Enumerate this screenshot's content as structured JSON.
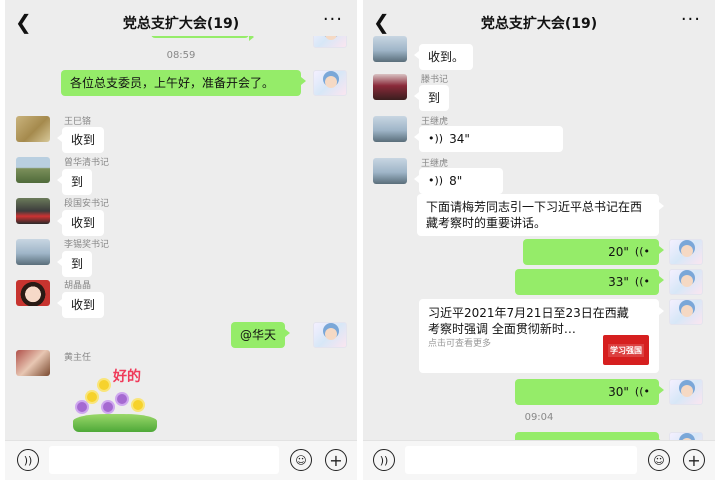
{
  "left": {
    "header": {
      "title": "党总支扩大会(19)"
    },
    "time_1": "08:59",
    "self_message": "各位总支委员，上午好，准备开会了。",
    "messages": [
      {
        "sender": "王巳铬",
        "text": "收到"
      },
      {
        "sender": "曾华清书记",
        "text": "到"
      },
      {
        "sender": "段国安书记",
        "text": "收到"
      },
      {
        "sender": "李锡奖书记",
        "text": "到"
      },
      {
        "sender": "胡晶晶",
        "text": "收到"
      }
    ],
    "mention_message": "@华天",
    "sticker_sender": "黄主任",
    "sticker_text": "好的"
  },
  "right": {
    "header": {
      "title": "党总支扩大会(19)"
    },
    "top_partial": {
      "sender": "王继虎",
      "text": "收到。"
    },
    "messages": [
      {
        "sender": "滕书记",
        "text": "到"
      }
    ],
    "voice_in": [
      {
        "sender": "王继虎",
        "duration": "34\""
      },
      {
        "sender": "王继虎",
        "duration": "8\""
      }
    ],
    "notice_text": "下面请梅芳同志引一下习近平总书记在西藏考察时的重要讲话。",
    "voice_out": [
      {
        "duration": "20\""
      },
      {
        "duration": "33\""
      }
    ],
    "article": {
      "title": "习近平2021年7月21日至23日在西藏考察时强调 全面贯彻新时…",
      "subtitle": "点击可查看更多",
      "logo_text": "学习强国"
    },
    "voice_out_2": {
      "duration": "30\""
    },
    "time_2": "09:04"
  }
}
